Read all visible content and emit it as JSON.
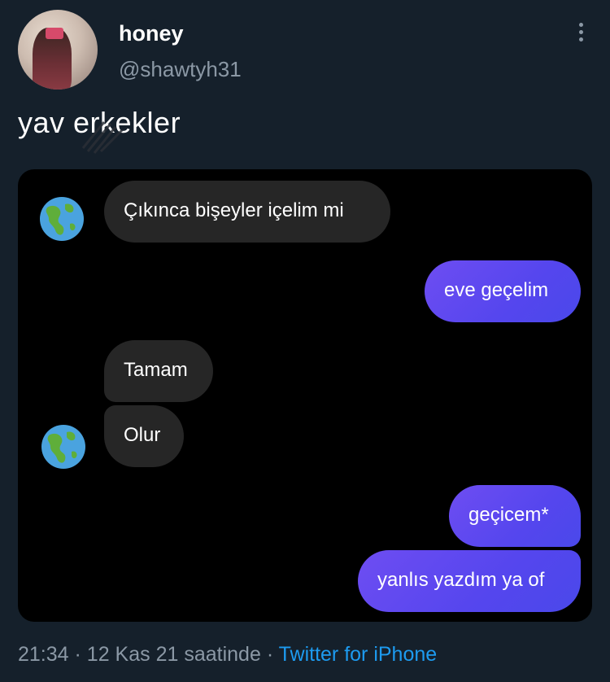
{
  "user": {
    "display_name": "honey",
    "handle": "@shawtyh31"
  },
  "tweet": {
    "text": "yav erkekler"
  },
  "chat": {
    "messages": [
      {
        "side": "in",
        "text": "Çıkınca bişeyler içelim mi"
      },
      {
        "side": "out",
        "text": "eve geçelim"
      },
      {
        "side": "in",
        "text": "Tamam"
      },
      {
        "side": "in",
        "text": "Olur"
      },
      {
        "side": "out",
        "text": "geçicem*"
      },
      {
        "side": "out",
        "text": "yanlıs yazdım ya of"
      }
    ]
  },
  "meta": {
    "time": "21:34",
    "separator": "·",
    "date": "12 Kas 21 saatinde",
    "source": "Twitter for iPhone"
  },
  "icons": {
    "menu": "more-vertical-icon",
    "contact_avatar": "globe-americas-icon"
  },
  "colors": {
    "background": "#15202b",
    "chat_background": "#000000",
    "incoming_bubble": "#262626",
    "outgoing_bubble": "#5546ee",
    "link": "#1d9bf0",
    "secondary_text": "#8b98a5"
  }
}
